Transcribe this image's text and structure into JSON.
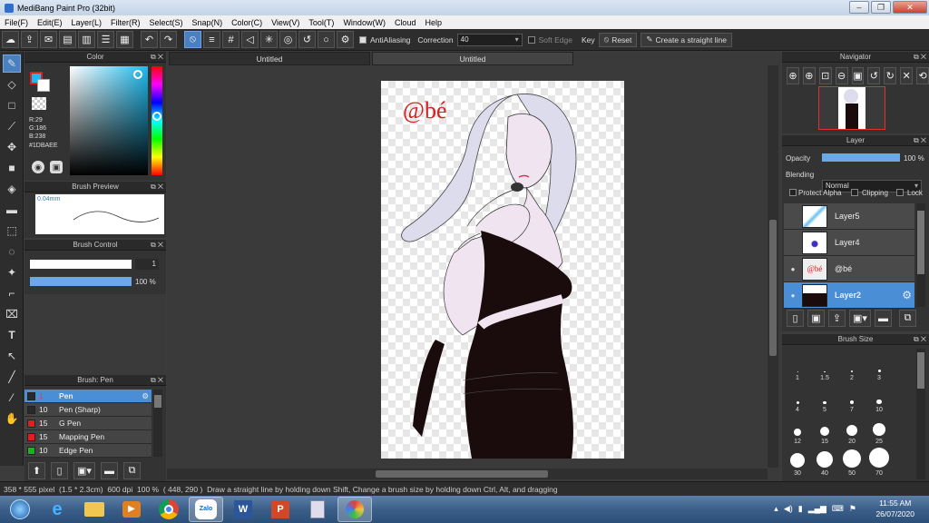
{
  "window": {
    "title": "MediBang Paint Pro (32bit)",
    "min": "–",
    "max": "❐",
    "close": "✕"
  },
  "menu": [
    "File(F)",
    "Edit(E)",
    "Layer(L)",
    "Filter(R)",
    "Select(S)",
    "Snap(N)",
    "Color(C)",
    "View(V)",
    "Tool(T)",
    "Window(W)",
    "Cloud",
    "Help"
  ],
  "toolbar": {
    "antialias_label": "AntiAliasing",
    "correction_label": "Correction",
    "correction_value": "40",
    "soft_edge_label": "Soft Edge",
    "key_label": "Key",
    "reset_label": "Reset",
    "straight_line_label": "Create a straight line"
  },
  "color_panel": {
    "title": "Color",
    "r": "R:29",
    "g": "G:186",
    "b": "B:238",
    "hex": "#1DBAEE",
    "fg_color": "#1DBAEE"
  },
  "brush_preview": {
    "title": "Brush Preview",
    "size_label": "0.04mm"
  },
  "brush_control": {
    "title": "Brush Control",
    "size_value": "1",
    "opacity_value": "100 %"
  },
  "brush_list": {
    "title": "Brush: Pen",
    "items": [
      {
        "size": "1",
        "name": "Pen",
        "color": "#2a2a2a",
        "selected": true
      },
      {
        "size": "10",
        "name": "Pen (Sharp)",
        "color": "#2a2a2a",
        "selected": false
      },
      {
        "size": "15",
        "name": "G Pen",
        "color": "#e02020",
        "selected": false
      },
      {
        "size": "15",
        "name": "Mapping Pen",
        "color": "#e02020",
        "selected": false
      },
      {
        "size": "10",
        "name": "Edge Pen",
        "color": "#20b020",
        "selected": false
      }
    ]
  },
  "doc_tabs": [
    "Untitled",
    "Untitled"
  ],
  "canvas": {
    "watermark": "@bé"
  },
  "navigator": {
    "title": "Navigator"
  },
  "layer_panel": {
    "title": "Layer",
    "opacity_label": "Opacity",
    "opacity_value": "100 %",
    "blending_label": "Blending",
    "blending_value": "Normal",
    "protect_alpha_label": "Protect Alpha",
    "clipping_label": "Clipping",
    "lock_label": "Lock",
    "layers": [
      {
        "name": "Layer5",
        "visible": false,
        "selected": false
      },
      {
        "name": "Layer4",
        "visible": false,
        "selected": false
      },
      {
        "name": "@bé",
        "visible": true,
        "selected": false
      },
      {
        "name": "Layer2",
        "visible": true,
        "selected": true
      }
    ]
  },
  "brush_size": {
    "title": "Brush Size",
    "sizes": [
      "1",
      "1.5",
      "2",
      "3",
      "4",
      "5",
      "7",
      "10",
      "12",
      "15",
      "20",
      "25",
      "30",
      "40",
      "50",
      "70"
    ]
  },
  "status": {
    "dimensions": "358 * 555 pixel",
    "physical": "(1.5 * 2.3cm)",
    "dpi": "600 dpi",
    "zoom": "100 %",
    "coords": "( 448, 290 )",
    "hint": "Draw a straight line by holding down Shift, Change a brush size by holding down Ctrl, Alt, and dragging"
  },
  "taskbar": {
    "time": "11:55 AM",
    "date": "26/07/2020",
    "zalo": "Zalo"
  }
}
